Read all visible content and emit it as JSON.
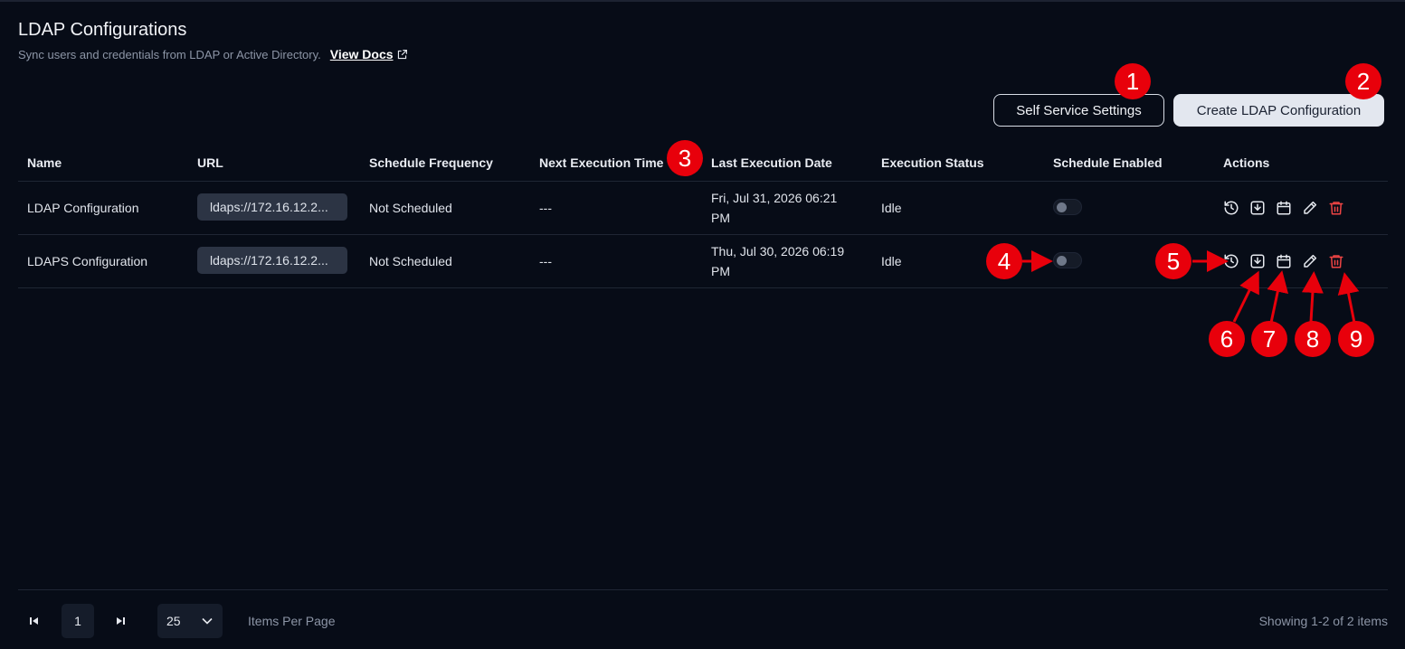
{
  "header": {
    "title": "LDAP Configurations",
    "subtitle": "Sync users and credentials from LDAP or Active Directory.",
    "docs_link": "View Docs"
  },
  "toolbar": {
    "self_service_label": "Self Service Settings",
    "create_label": "Create LDAP Configuration"
  },
  "table": {
    "columns": [
      "Name",
      "URL",
      "Schedule Frequency",
      "Next Execution Time",
      "Last Execution Date",
      "Execution Status",
      "Schedule Enabled",
      "Actions"
    ],
    "rows": [
      {
        "name": "LDAP Configuration",
        "url": "ldaps://172.16.12.2...",
        "frequency": "Not Scheduled",
        "next": "---",
        "last_line1": "Fri, Jul 31, 2026 06:21",
        "last_line2": "PM",
        "status": "Idle",
        "schedule_enabled": false
      },
      {
        "name": "LDAPS Configuration",
        "url": "ldaps://172.16.12.2...",
        "frequency": "Not Scheduled",
        "next": "---",
        "last_line1": "Thu, Jul 30, 2026 06:19",
        "last_line2": "PM",
        "status": "Idle",
        "schedule_enabled": false
      }
    ],
    "action_icons": [
      "history-icon",
      "download-icon",
      "calendar-icon",
      "pencil-icon",
      "trash-icon"
    ]
  },
  "pagination": {
    "current_page": "1",
    "per_page": "25",
    "per_page_label": "Items Per Page",
    "showing": "Showing 1-2 of 2 items"
  },
  "markers": [
    "1",
    "2",
    "3",
    "4",
    "5",
    "6",
    "7",
    "8",
    "9"
  ],
  "colors": {
    "background": "#070c17",
    "marker_red": "#e8000b",
    "delete_red": "#ef4444",
    "primary_button": "#e3e7ef"
  }
}
